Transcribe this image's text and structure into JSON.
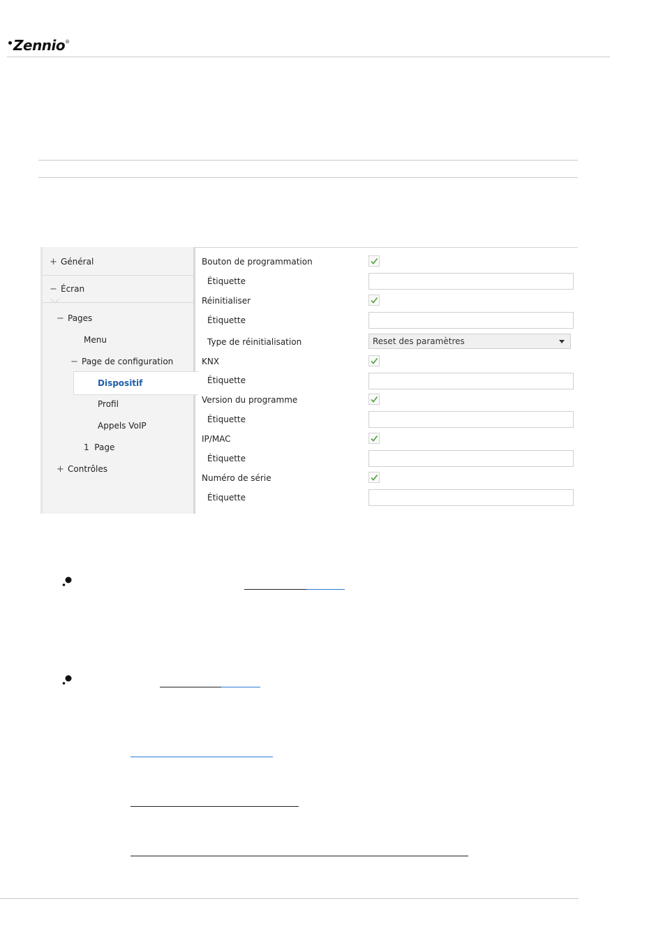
{
  "header": {
    "brand": "Zennio"
  },
  "tree": {
    "items": [
      {
        "symbol": "+",
        "label": "Général"
      },
      {
        "symbol": "−",
        "label": "Écran"
      },
      {
        "symbol": "−",
        "label": "Pages"
      },
      {
        "symbol": "",
        "label": "Menu"
      },
      {
        "symbol": "−",
        "label": "Page de configuration"
      },
      {
        "symbol": "",
        "label": "Dispositif"
      },
      {
        "symbol": "",
        "label": "Profil"
      },
      {
        "symbol": "",
        "label": "Appels VoIP"
      },
      {
        "symbol": "1",
        "label": "Page"
      },
      {
        "symbol": "+",
        "label": "Contrôles"
      }
    ]
  },
  "params": {
    "rows": [
      {
        "label": "Bouton de programmation",
        "control": "checkbox",
        "checked": true
      },
      {
        "label": "Étiquette",
        "control": "text",
        "value": ""
      },
      {
        "label": "Réinitialiser",
        "control": "checkbox",
        "checked": true
      },
      {
        "label": "Étiquette",
        "control": "text",
        "value": ""
      },
      {
        "label": "Type de réinitialisation",
        "control": "select",
        "value": "Reset des paramètres"
      },
      {
        "label": "KNX",
        "control": "checkbox",
        "checked": true
      },
      {
        "label": "Étiquette",
        "control": "text",
        "value": ""
      },
      {
        "label": "Version du programme",
        "control": "checkbox",
        "checked": true
      },
      {
        "label": "Étiquette",
        "control": "text",
        "value": ""
      },
      {
        "label": "IP/MAC",
        "control": "checkbox",
        "checked": true
      },
      {
        "label": "Étiquette",
        "control": "text",
        "value": ""
      },
      {
        "label": "Numéro de série",
        "control": "checkbox",
        "checked": true
      },
      {
        "label": "Étiquette",
        "control": "text",
        "value": ""
      }
    ]
  },
  "colors": {
    "accent_blue": "#1f5fa8",
    "link_blue": "#2a7bd4",
    "check_green": "#5aa64a"
  }
}
